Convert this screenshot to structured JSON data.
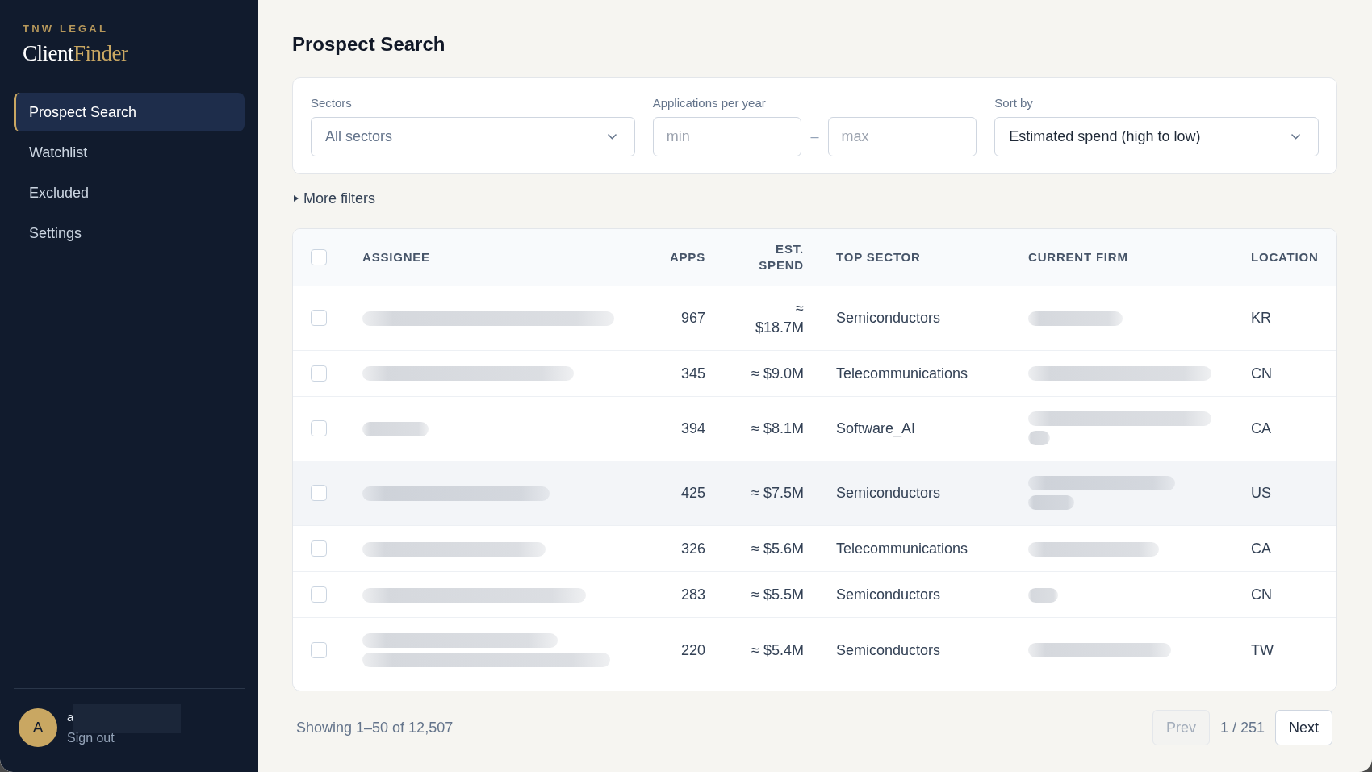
{
  "sidebar": {
    "brand": {
      "eyebrow": "TNW LEGAL",
      "name": "Client",
      "name_accent": "Finder"
    },
    "nav": [
      {
        "label": "Prospect Search",
        "selected": true
      },
      {
        "label": "Watchlist",
        "selected": false
      },
      {
        "label": "Excluded",
        "selected": false
      },
      {
        "label": "Settings",
        "selected": false
      }
    ],
    "user": {
      "initial": "A",
      "name": "a",
      "name_redacted": true,
      "action": "Sign out"
    }
  },
  "main": {
    "title": "Prospect Search",
    "filters": {
      "sectors": {
        "label": "Sectors",
        "placeholder": "All sectors"
      },
      "applications": {
        "label": "Applications per year",
        "min_placeholder": "min",
        "separator": "–",
        "max_placeholder": "max"
      },
      "sort": {
        "label": "Sort by",
        "value": "Estimated spend (high to low)"
      }
    },
    "more_filters": {
      "label": "More filters",
      "expanded": false
    },
    "table": {
      "select_all": {
        "checked": false
      },
      "columns": [
        "ASSIGNEE",
        "APPS",
        "EST. SPEND",
        "TOP SECTOR",
        "CURRENT FIRM",
        "LOCATION"
      ],
      "rows": [
        {
          "checked": false,
          "hovered": false,
          "assignee_redacted": true,
          "apps": "967",
          "spend": "≈ $18.7M",
          "sector": "Semiconductors",
          "firm_redacted": true,
          "location": "KR"
        },
        {
          "checked": false,
          "hovered": false,
          "assignee_redacted": true,
          "apps": "345",
          "spend": "≈ $9.0M",
          "sector": "Telecommunications",
          "firm_redacted": true,
          "location": "CN"
        },
        {
          "checked": false,
          "hovered": false,
          "assignee_redacted": true,
          "apps": "394",
          "spend": "≈ $8.1M",
          "sector": "Software_AI",
          "firm_redacted": true,
          "location": "CA"
        },
        {
          "checked": false,
          "hovered": true,
          "assignee_redacted": true,
          "apps": "425",
          "spend": "≈ $7.5M",
          "sector": "Semiconductors",
          "firm_redacted": true,
          "location": "US"
        },
        {
          "checked": false,
          "hovered": false,
          "assignee_redacted": true,
          "apps": "326",
          "spend": "≈ $5.6M",
          "sector": "Telecommunications",
          "firm_redacted": true,
          "location": "CA"
        },
        {
          "checked": false,
          "hovered": false,
          "assignee_redacted": true,
          "apps": "283",
          "spend": "≈ $5.5M",
          "sector": "Semiconductors",
          "firm_redacted": true,
          "location": "CN"
        },
        {
          "checked": false,
          "hovered": false,
          "assignee_redacted": true,
          "apps": "220",
          "spend": "≈ $5.4M",
          "sector": "Semiconductors",
          "firm_redacted": true,
          "location": "TW"
        }
      ]
    },
    "footer": {
      "summary": "Showing 1–50 of 12,507",
      "prev": {
        "label": "Prev",
        "disabled": true
      },
      "page": "1 / 251",
      "next": {
        "label": "Next",
        "disabled": false
      }
    }
  }
}
